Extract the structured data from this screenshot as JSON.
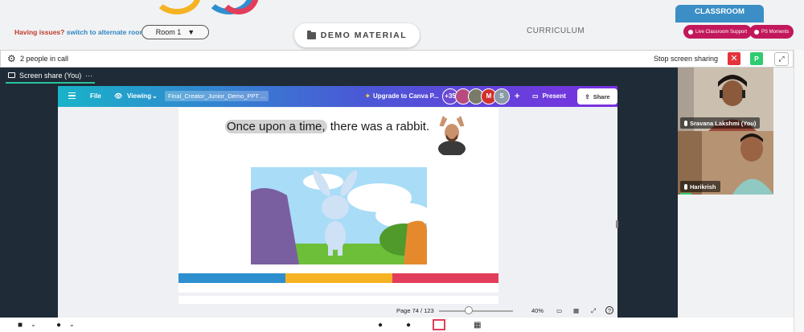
{
  "header": {
    "issues_text": "Having issues?",
    "alt_room_link": "switch to alternate room",
    "room_select": "Room 1",
    "demo_material": "DEMO MATERIAL",
    "curriculum": "CURRICULUM",
    "classroom_tab": "CLASSROOM",
    "live_support": "Live Classroom Support",
    "ps_moments": "PS Moments"
  },
  "call": {
    "people_count": "2 people in call",
    "stop_sharing": "Stop screen sharing",
    "presenter_badge": "P"
  },
  "share_tab": {
    "label": "Screen share (You)",
    "more": "···"
  },
  "canva": {
    "file": "File",
    "viewing": "Viewing",
    "filename": "Final_Creator_Junior_Demo_PPT ...",
    "upgrade": "Upgrade to Canva P...",
    "avatar_count": "+35",
    "avatar_m": "M",
    "avatar_s": "S",
    "plus": "+",
    "present": "Present",
    "share": "Share",
    "page": "Page 74 / 123",
    "zoom_level": "40%",
    "zoom_fraction": 0.4,
    "help": "?"
  },
  "slide": {
    "highlight": "Once upon a time,",
    "rest": " there was a rabbit."
  },
  "participants": [
    {
      "name": "Sravana Lakshmi (You)"
    },
    {
      "name": "Harikrish"
    }
  ],
  "colors": {
    "accent_red": "#c2185b",
    "classroom_blue": "#3b8fc6",
    "stripe_blue": "#2e8fd0",
    "stripe_yellow": "#f5b324",
    "stripe_red": "#e23d5b"
  }
}
